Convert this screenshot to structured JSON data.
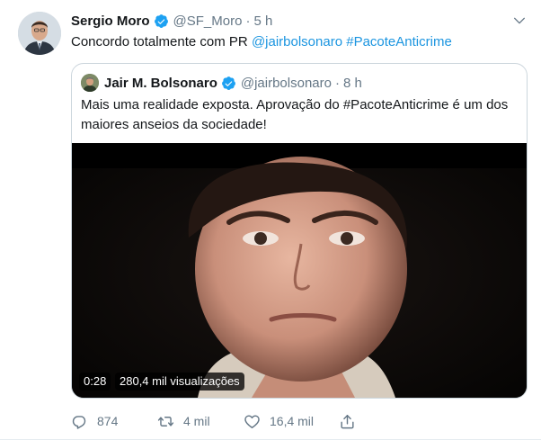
{
  "tweet": {
    "author": {
      "name": "Sergio Moro",
      "handle": "@SF_Moro",
      "time": "5 h"
    },
    "text": {
      "prefix": "Concordo totalmente com PR ",
      "mention": "@jairbolsonaro",
      "space": " ",
      "hashtag": "#PacoteAnticrime"
    },
    "separator": "·",
    "actions": {
      "replies": "874",
      "retweets": "4 mil",
      "likes": "16,4 mil"
    }
  },
  "quote": {
    "author": {
      "name": "Jair M. Bolsonaro",
      "handle": "@jairbolsonaro",
      "time": "8 h"
    },
    "text": "Mais uma realidade exposta. Aprovação do #PacoteAnticrime é um dos maiores anseios da sociedade!",
    "video": {
      "duration": "0:28",
      "views": "280,4 mil visualizações"
    }
  },
  "colors": {
    "link": "#1b95e0",
    "verified": "#1da1f2",
    "muted": "#657786",
    "border": "#ccd6dd"
  },
  "icons": [
    "verified-badge-icon",
    "chevron-down-icon",
    "reply-icon",
    "retweet-icon",
    "like-icon",
    "share-icon"
  ]
}
